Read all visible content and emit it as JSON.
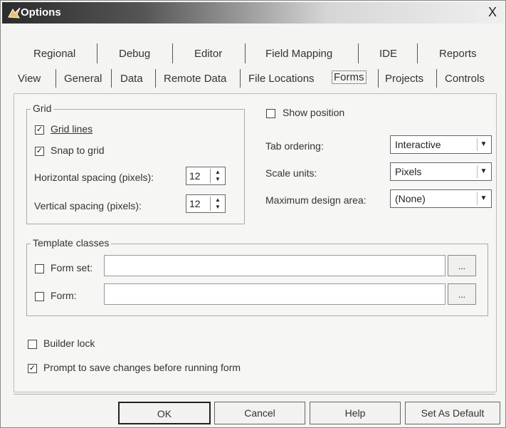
{
  "window": {
    "title": "Options",
    "close_label": "X"
  },
  "tabs_row1": [
    "Regional",
    "Debug",
    "Editor",
    "Field Mapping",
    "IDE",
    "Reports"
  ],
  "tabs_row2": [
    "View",
    "General",
    "Data",
    "Remote Data",
    "File Locations",
    "Forms",
    "Projects",
    "Controls"
  ],
  "active_tab": "Forms",
  "grid": {
    "legend": "Grid",
    "grid_lines_label": "Grid lines",
    "grid_lines_checked": true,
    "snap_label": "Snap to grid",
    "snap_checked": true,
    "h_spacing_label": "Horizontal spacing (pixels):",
    "h_spacing_value": "12",
    "v_spacing_label": "Vertical spacing (pixels):",
    "v_spacing_value": "12"
  },
  "right": {
    "show_position_label": "Show position",
    "show_position_checked": false,
    "tab_ordering_label": "Tab ordering:",
    "tab_ordering_value": "Interactive",
    "scale_units_label": "Scale units:",
    "scale_units_value": "Pixels",
    "max_design_label": "Maximum design area:",
    "max_design_value": "(None)"
  },
  "template": {
    "legend": "Template classes",
    "form_set_label": "Form set:",
    "form_set_checked": false,
    "form_label": "Form:",
    "form_checked": false,
    "browse_label": "..."
  },
  "builder_lock_label": "Builder lock",
  "builder_lock_checked": false,
  "prompt_save_label": "Prompt to save changes before running form",
  "prompt_save_checked": true,
  "buttons": {
    "ok": "OK",
    "cancel": "Cancel",
    "help": "Help",
    "set_default": "Set As Default"
  }
}
